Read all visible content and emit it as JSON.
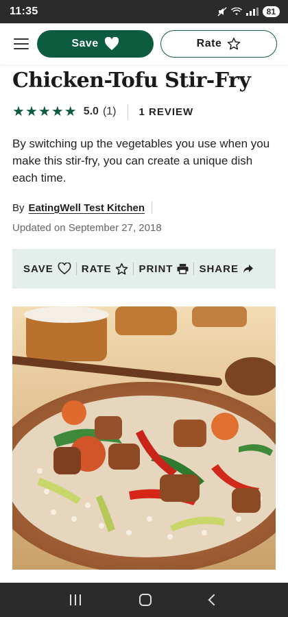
{
  "status": {
    "time": "11:35",
    "battery": "81"
  },
  "header": {
    "save_label": "Save",
    "rate_label": "Rate"
  },
  "recipe": {
    "title": "Chicken-Tofu Stir-Fry",
    "rating_value": "5.0",
    "rating_count": "(1)",
    "stars": 5,
    "review_count": "1 REVIEW",
    "description": "By switching up the vegetables you use when you make this stir-fry, you can create a unique dish each time.",
    "by_label": "By",
    "author": "EatingWell Test Kitchen",
    "updated": "Updated on September 27, 2018"
  },
  "actions": {
    "save": "SAVE",
    "rate": "RATE",
    "print": "PRINT",
    "share": "SHARE"
  },
  "colors": {
    "brand": "#0d5c3f",
    "action_bar_bg": "#e4efeb"
  }
}
